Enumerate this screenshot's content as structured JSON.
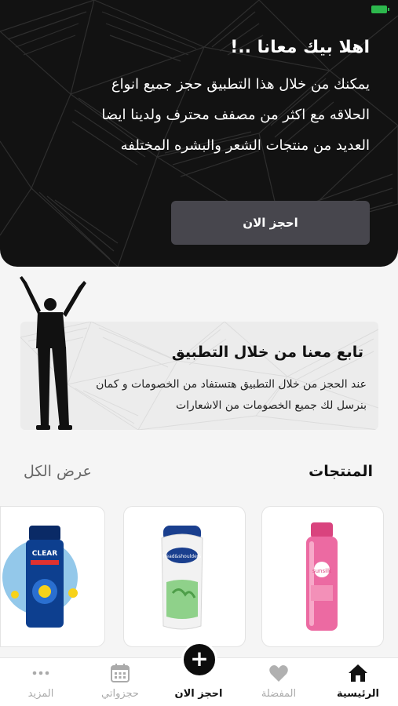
{
  "hero": {
    "title": "اهلا بيك معانا ..!",
    "text": "يمكنك من خلال هذا التطبيق حجز جميع انواع الحلاقه مع اكثر من مصفف محترف ولدينا ايضا العديد من منتجات الشعر والبشره المختلفه",
    "button_label": "احجز الان"
  },
  "follow": {
    "title": "تابع معنا من خلال التطبيق",
    "text": "عند الحجز من خلال التطبيق هتستفاد من الخصومات و كمان بنرسل لك جميع الخصومات من الاشعارات"
  },
  "products": {
    "title": "المنتجات",
    "view_all": "عرض الكل",
    "items": [
      {
        "icon": "sunsilk-bottle",
        "brand": "sunsilk",
        "color": "#e9609a"
      },
      {
        "icon": "head-shoulders-bottle",
        "brand": "head&shoulders",
        "color": "#f2f2f2"
      },
      {
        "icon": "clear-bottle",
        "brand": "CLEAR",
        "color": "#0d3f8f"
      }
    ]
  },
  "nav": {
    "items": [
      {
        "label": "الرئيسية",
        "icon": "home-icon",
        "active": true
      },
      {
        "label": "المفضلة",
        "icon": "heart-icon",
        "active": false
      },
      {
        "label": "احجز الان",
        "icon": "plus-icon",
        "active": true
      },
      {
        "label": "حجزواتي",
        "icon": "calendar-icon",
        "active": false
      },
      {
        "label": "المزيد",
        "icon": "more-icon",
        "active": false
      }
    ],
    "fab_symbol": "+"
  },
  "colors": {
    "dark": "#121212",
    "button": "#47464d",
    "status_green": "#2db84d"
  }
}
